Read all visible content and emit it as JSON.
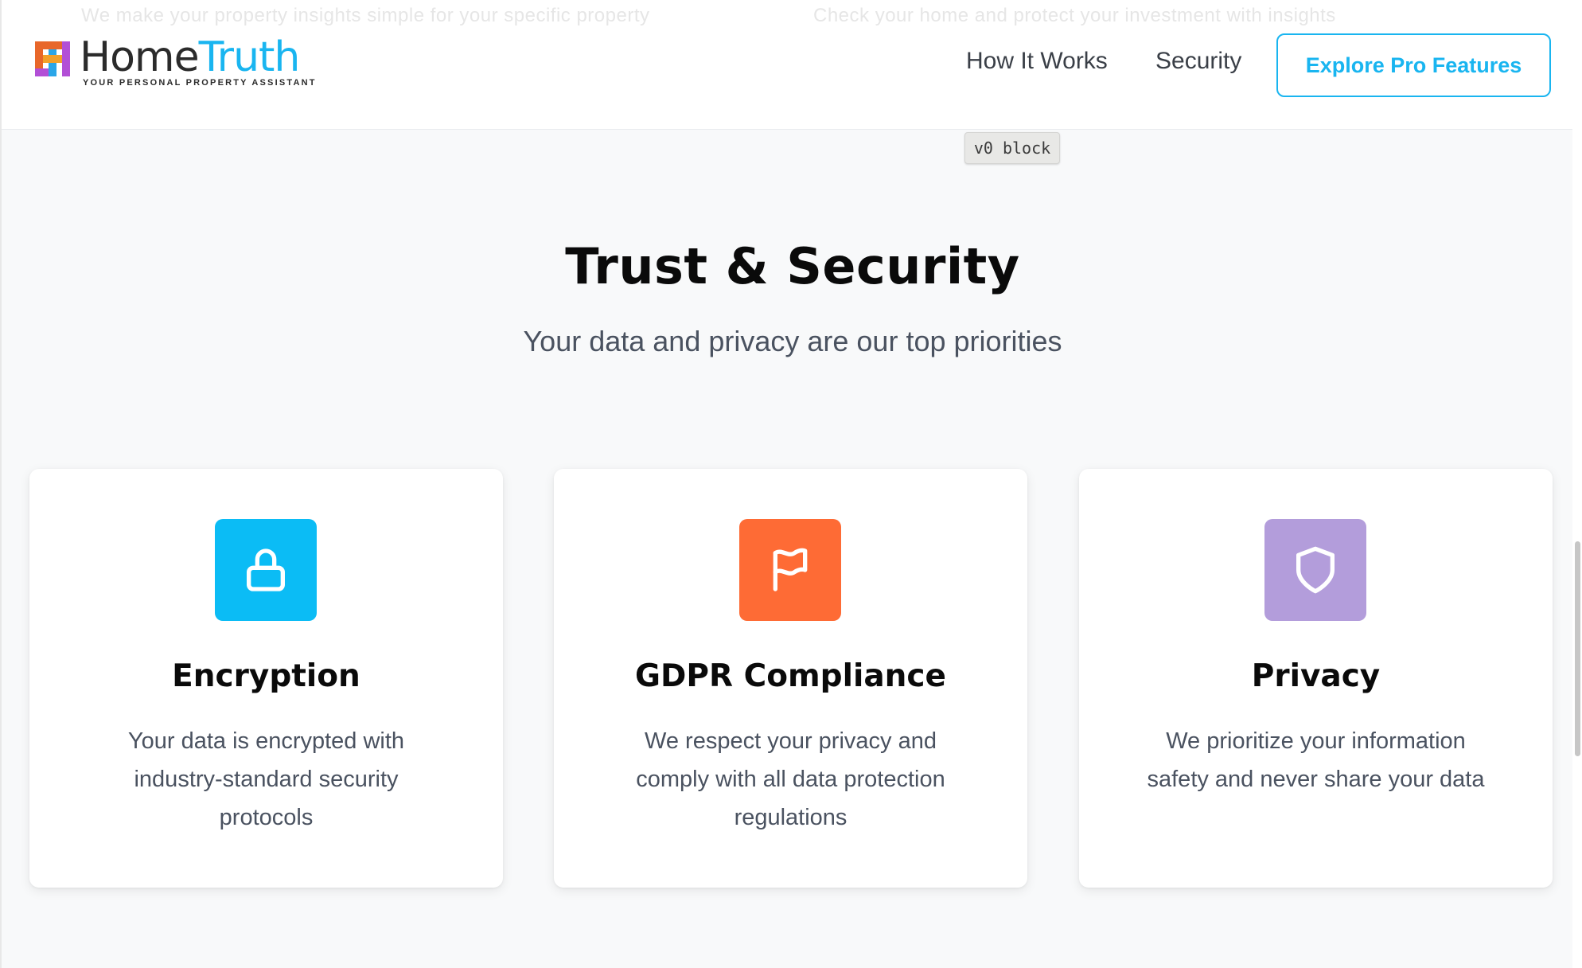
{
  "header": {
    "ghost_text_left": "We make your property insights simple for your specific property",
    "ghost_text_right": "Check your home and protect your investment with insights",
    "logo": {
      "word_part_1": "Home",
      "word_part_2": "Truth",
      "tagline": "YOUR PERSONAL PROPERTY ASSISTANT",
      "mark_colors": [
        "#e8672a",
        "#2aa6e8",
        "#b24fd6",
        "#f2a02b"
      ]
    },
    "nav": [
      {
        "label": "How It Works"
      },
      {
        "label": "Security"
      }
    ],
    "cta_label": "Explore Pro Features",
    "accent_color": "#19b5f0"
  },
  "badge": {
    "label": "v0 block"
  },
  "section": {
    "title": "Trust & Security",
    "subtitle": "Your data and privacy are our top priorities"
  },
  "cards": [
    {
      "icon": "lock-icon",
      "color": "#0bbcf5",
      "title": "Encryption",
      "description": "Your data is encrypted with industry-standard security protocols"
    },
    {
      "icon": "flag-icon",
      "color": "#fe6b35",
      "title": "GDPR Compliance",
      "description": "We respect your privacy and comply with all data protection regulations"
    },
    {
      "icon": "shield-icon",
      "color": "#b39ddb",
      "title": "Privacy",
      "description": "We prioritize your information safety and never share your data"
    }
  ]
}
